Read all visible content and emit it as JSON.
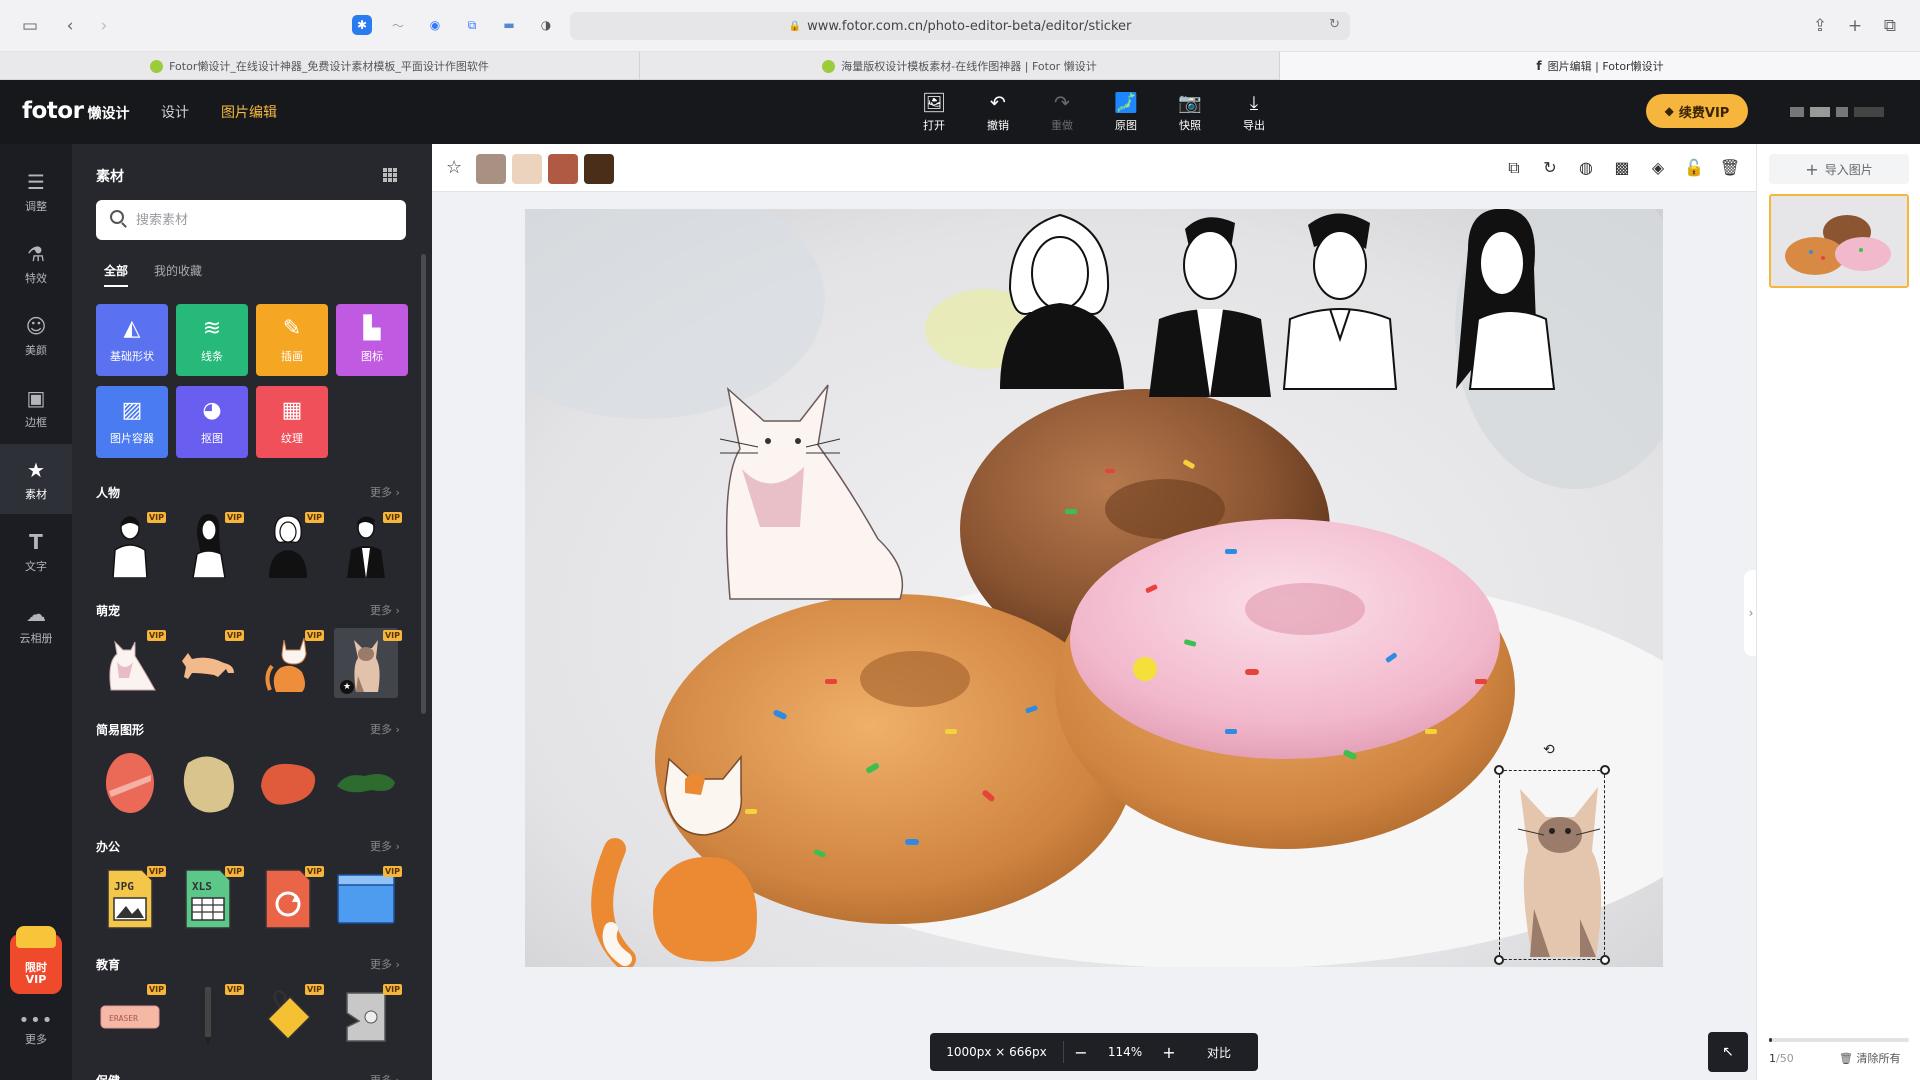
{
  "browser": {
    "url": "www.fotor.com.cn/photo-editor-beta/editor/sticker",
    "tabs": [
      {
        "title": "Fotor懒设计_在线设计神器_免费设计素材模板_平面设计作图软件"
      },
      {
        "title": "海量版权设计模板素材-在线作图神器 | Fotor 懒设计"
      },
      {
        "title": "图片编辑 | Fotor懒设计"
      }
    ]
  },
  "header": {
    "logo": "fotor",
    "logo_sub": "懒设计",
    "nav_design": "设计",
    "nav_edit": "图片编辑",
    "tools": [
      {
        "label": "打开",
        "icon": "open-image-icon",
        "glyph": "🖼"
      },
      {
        "label": "撤销",
        "icon": "undo-icon",
        "glyph": "↶"
      },
      {
        "label": "重做",
        "icon": "redo-icon",
        "glyph": "↷"
      },
      {
        "label": "原图",
        "icon": "original-image-icon",
        "glyph": "🗾"
      },
      {
        "label": "快照",
        "icon": "snapshot-icon",
        "glyph": "📷"
      },
      {
        "label": "导出",
        "icon": "export-icon",
        "glyph": "⤓"
      }
    ],
    "vip_label": "续费VIP"
  },
  "rail": {
    "items": [
      {
        "label": "调整",
        "icon": "adjust-icon",
        "glyph": "☰"
      },
      {
        "label": "特效",
        "icon": "effects-icon",
        "glyph": "⚗"
      },
      {
        "label": "美颜",
        "icon": "beauty-icon",
        "glyph": "☺"
      },
      {
        "label": "边框",
        "icon": "frame-icon",
        "glyph": "▣"
      },
      {
        "label": "素材",
        "icon": "sticker-icon",
        "glyph": "★"
      },
      {
        "label": "文字",
        "icon": "text-icon",
        "glyph": "T"
      },
      {
        "label": "云相册",
        "icon": "cloud-icon",
        "glyph": "☁"
      }
    ],
    "gift_line1": "限时",
    "gift_line2": "VIP",
    "more_label": "更多"
  },
  "panel": {
    "title": "素材",
    "search_placeholder": "搜索素材",
    "tabs": [
      "全部",
      "我的收藏"
    ],
    "categories": [
      {
        "label": "基础形状",
        "color": "#5a72f0",
        "glyph": "◭"
      },
      {
        "label": "线条",
        "color": "#27b97a",
        "glyph": "≋"
      },
      {
        "label": "插画",
        "color": "#f5a623",
        "glyph": "✎"
      },
      {
        "label": "图标",
        "color": "#c05ae0",
        "glyph": "▙"
      },
      {
        "label": "图片容器",
        "color": "#4a7bf0",
        "glyph": "▨"
      },
      {
        "label": "抠图",
        "color": "#6a5ef0",
        "glyph": "◕"
      },
      {
        "label": "纹理",
        "color": "#f0505a",
        "glyph": "▦"
      }
    ],
    "sections": [
      {
        "title": "人物",
        "more": "更多"
      },
      {
        "title": "萌宠",
        "more": "更多"
      },
      {
        "title": "简易图形",
        "more": "更多"
      },
      {
        "title": "办公",
        "more": "更多"
      },
      {
        "title": "教育",
        "more": "更多"
      },
      {
        "title": "保健",
        "more": "更多"
      }
    ],
    "vip_tag": "VIP",
    "office_labels": {
      "jpg": "JPG",
      "xls": "XLS"
    },
    "eraser_label": "ERASER"
  },
  "toolbar": {
    "swatches": [
      "#a89083",
      "#ecd3bd",
      "#b05a44",
      "#4a2e1a"
    ]
  },
  "zoom": {
    "size": "1000px × 666px",
    "minus": "−",
    "percent": "114%",
    "plus": "+",
    "compare": "对比"
  },
  "pages": {
    "import_label": "导入图片",
    "current": "1",
    "total": "/50",
    "clear_label": "清除所有"
  }
}
